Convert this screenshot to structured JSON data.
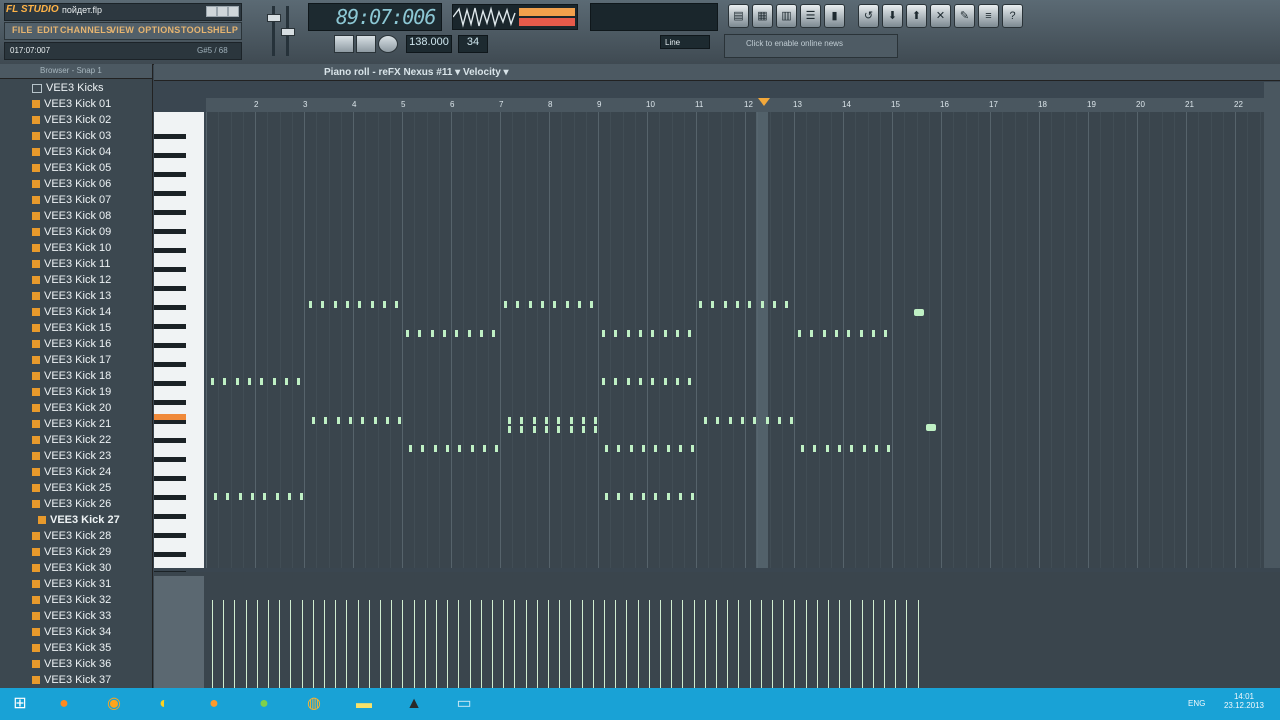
{
  "title_bar": {
    "logo": "FL STUDIO",
    "project": "пойдет.flp"
  },
  "menu": [
    "FILE",
    "EDIT",
    "CHANNELS",
    "VIEW",
    "OPTIONS",
    "TOOLS",
    "HELP"
  ],
  "hint": {
    "left": "017:07:007",
    "right": "G#5 / 68"
  },
  "time_display": "89:07:006",
  "tempo": "138.000",
  "pattern": "34",
  "snap_mode": "Line",
  "news": "Click to enable online news",
  "browser": {
    "title": "Browser - Snap 1",
    "folder": "VEE3 Kicks",
    "selected": "VEE3 Kick 27",
    "items": [
      "VEE3 Kick 01",
      "VEE3 Kick 02",
      "VEE3 Kick 03",
      "VEE3 Kick 04",
      "VEE3 Kick 05",
      "VEE3 Kick 06",
      "VEE3 Kick 07",
      "VEE3 Kick 08",
      "VEE3 Kick 09",
      "VEE3 Kick 10",
      "VEE3 Kick 11",
      "VEE3 Kick 12",
      "VEE3 Kick 13",
      "VEE3 Kick 14",
      "VEE3 Kick 15",
      "VEE3 Kick 16",
      "VEE3 Kick 17",
      "VEE3 Kick 18",
      "VEE3 Kick 19",
      "VEE3 Kick 20",
      "VEE3 Kick 21",
      "VEE3 Kick 22",
      "VEE3 Kick 23",
      "VEE3 Kick 24",
      "VEE3 Kick 25",
      "VEE3 Kick 26",
      "VEE3 Kick 27",
      "VEE3 Kick 28",
      "VEE3 Kick 29",
      "VEE3 Kick 30",
      "VEE3 Kick 31",
      "VEE3 Kick 32",
      "VEE3 Kick 33",
      "VEE3 Kick 34",
      "VEE3 Kick 35",
      "VEE3 Kick 36",
      "VEE3 Kick 37"
    ]
  },
  "piano_roll": {
    "title": "Piano roll - reFX Nexus #11",
    "param": "Velocity",
    "bars": [
      "2",
      "3",
      "4",
      "5",
      "6",
      "7",
      "8",
      "9",
      "10",
      "11",
      "12",
      "13",
      "14",
      "15",
      "16",
      "17",
      "18",
      "19",
      "20",
      "21",
      "22"
    ]
  },
  "taskbar": {
    "lang": "ENG",
    "time": "14:01",
    "date": "23.12.2013"
  },
  "colors": {
    "note": "#bff0c4",
    "accent": "#e89a2c",
    "taskbar": "#19a2d6"
  }
}
